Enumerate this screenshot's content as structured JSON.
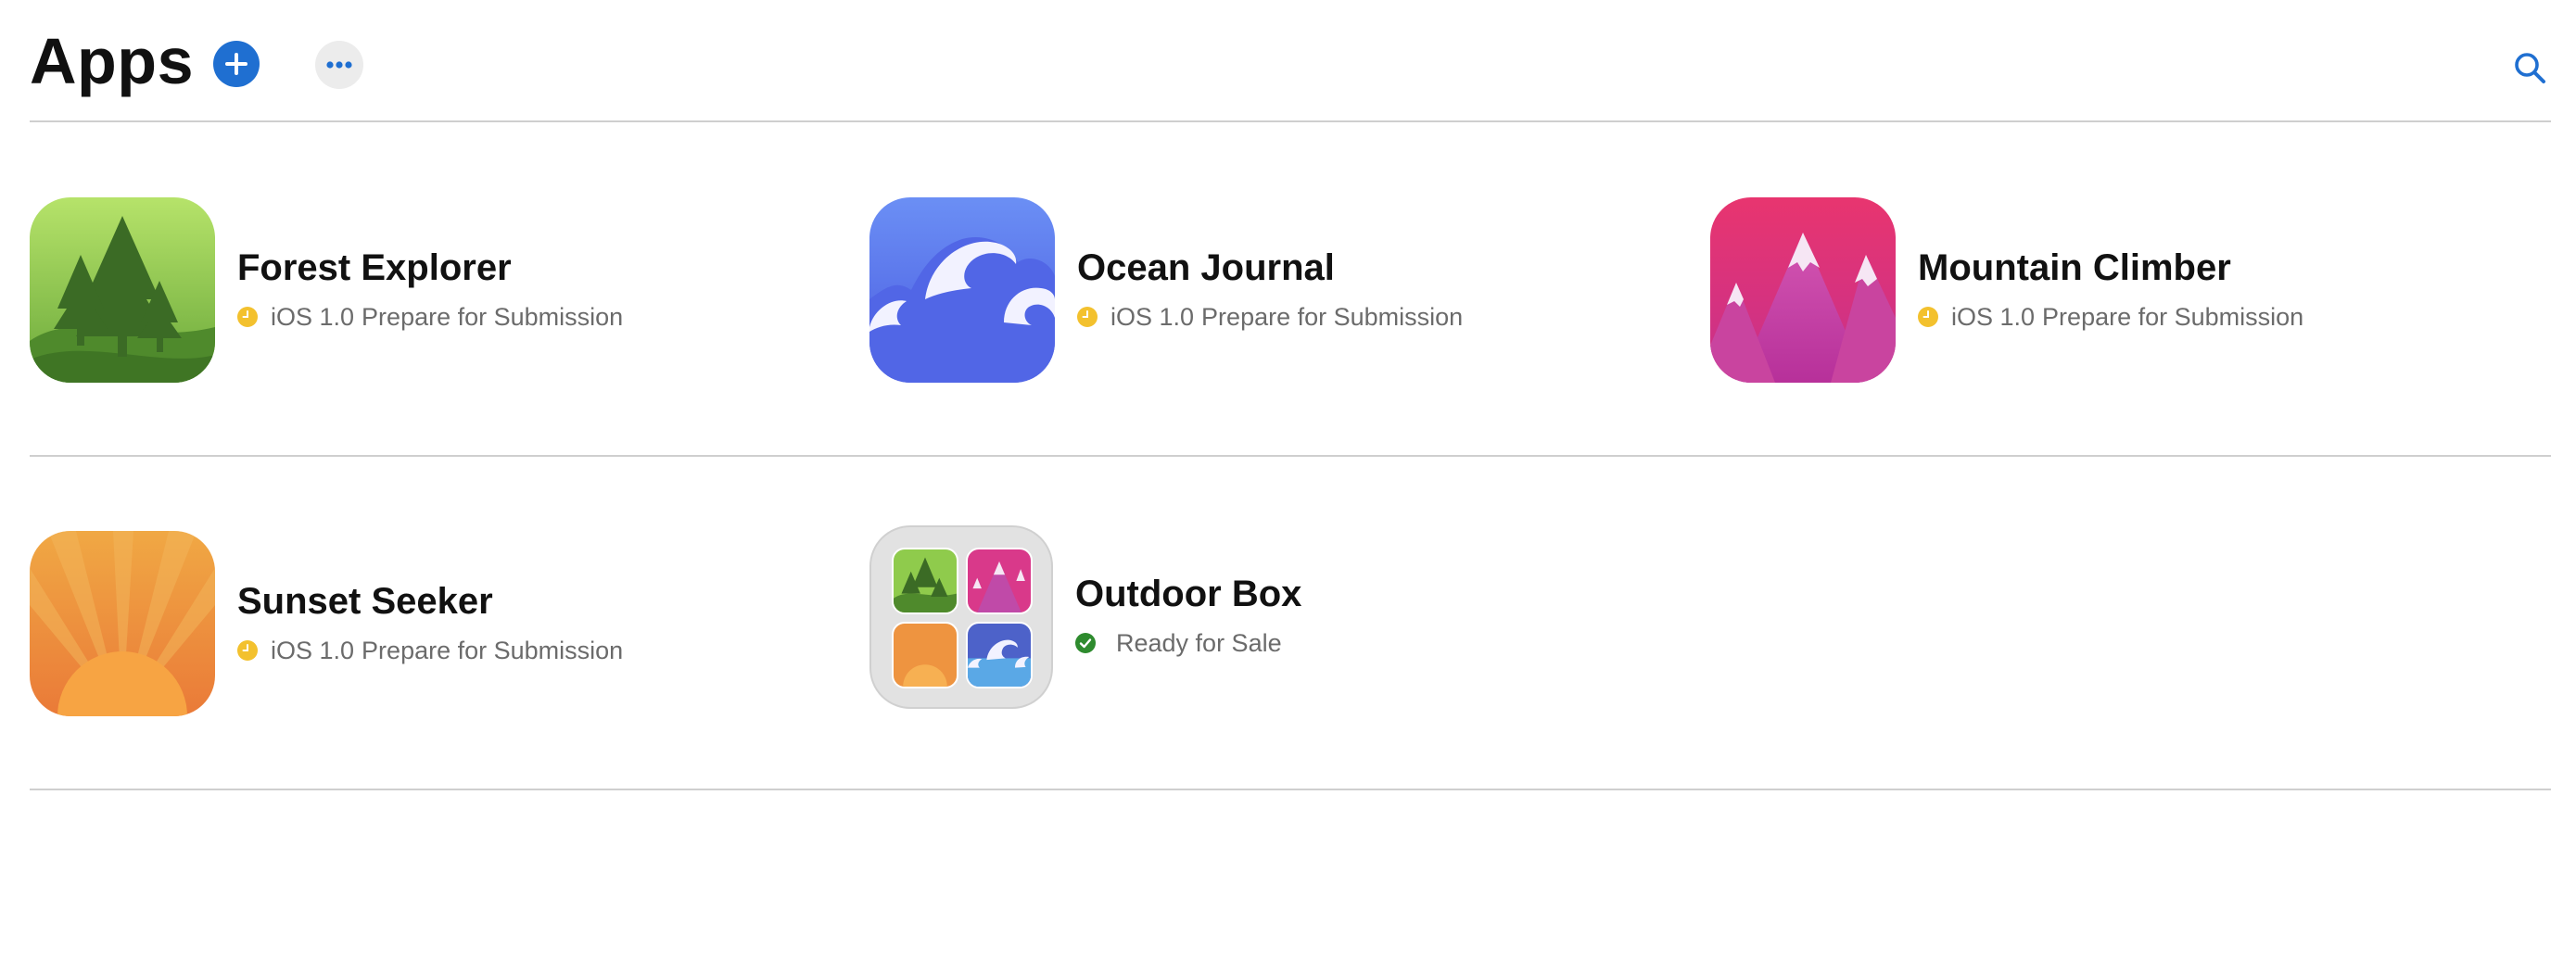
{
  "header": {
    "title": "Apps",
    "add_icon": "plus-icon",
    "more_icon": "ellipsis-icon",
    "search_icon": "search-icon",
    "accent_color": "#1f6fd1"
  },
  "apps": [
    {
      "name": "Forest Explorer",
      "version": "iOS 1.0",
      "status": "Prepare for Submission",
      "status_icon": "clock-icon",
      "status_color": "#f3c12e",
      "icon": "forest-icon"
    },
    {
      "name": "Ocean Journal",
      "version": "iOS 1.0",
      "status": "Prepare for Submission",
      "status_icon": "clock-icon",
      "status_color": "#f3c12e",
      "icon": "ocean-icon"
    },
    {
      "name": "Mountain Climber",
      "version": "iOS 1.0",
      "status": "Prepare for Submission",
      "status_icon": "clock-icon",
      "status_color": "#f3c12e",
      "icon": "mountain-icon"
    },
    {
      "name": "Sunset Seeker",
      "version": "iOS 1.0",
      "status": "Prepare for Submission",
      "status_icon": "clock-icon",
      "status_color": "#f3c12e",
      "icon": "sunset-icon"
    },
    {
      "name": "Outdoor Box",
      "version": "",
      "status": "Ready for Sale",
      "status_icon": "checkmark-icon",
      "status_color": "#2e8b2e",
      "icon": "bundle-icon"
    }
  ]
}
